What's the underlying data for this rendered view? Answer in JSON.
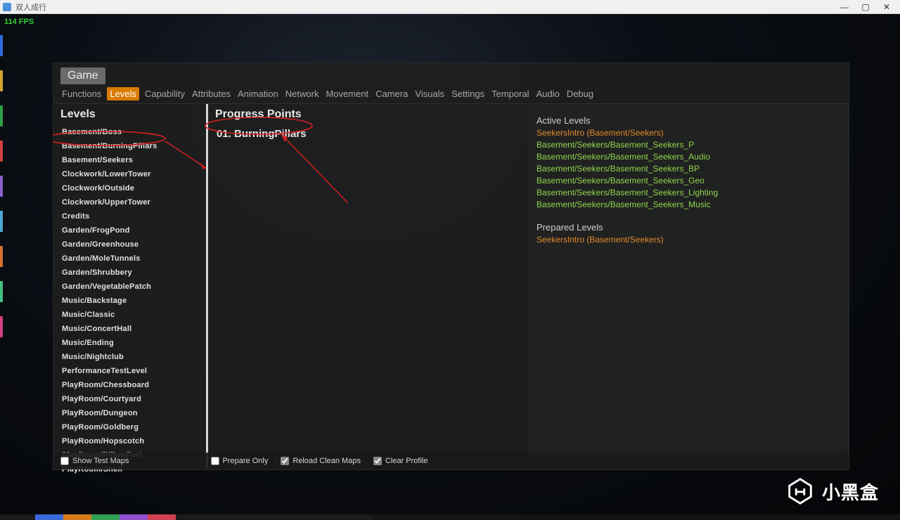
{
  "window": {
    "title": "双人成行"
  },
  "fps": "114 FPS",
  "panel": {
    "game_tab": "Game",
    "menu": {
      "items": [
        "Functions",
        "Levels",
        "Capability",
        "Attributes",
        "Animation",
        "Network",
        "Movement",
        "Camera",
        "Visuals",
        "Settings",
        "Temporal",
        "Audio",
        "Debug"
      ],
      "active": "Levels"
    }
  },
  "levels": {
    "title": "Levels",
    "items": [
      "Basement/Boss",
      "Basement/BurningPillars",
      "Basement/Seekers",
      "Clockwork/LowerTower",
      "Clockwork/Outside",
      "Clockwork/UpperTower",
      "Credits",
      "Garden/FrogPond",
      "Garden/Greenhouse",
      "Garden/MoleTunnels",
      "Garden/Shrubbery",
      "Garden/VegetablePatch",
      "Music/Backstage",
      "Music/Classic",
      "Music/ConcertHall",
      "Music/Ending",
      "Music/Nightclub",
      "PerformanceTestLevel",
      "PlayRoom/Chessboard",
      "PlayRoom/Courtyard",
      "PlayRoom/Dungeon",
      "PlayRoom/Goldberg",
      "PlayRoom/Hopscotch",
      "PlayRoom/PillowFort",
      "PlayRoom/Shelf"
    ],
    "circled_index": 1
  },
  "progress_points": {
    "title": "Progress Points",
    "items": [
      "01. BurningPillars"
    ],
    "circled_index": 0
  },
  "info": {
    "active_title": "Active Levels",
    "active": [
      {
        "text": "SeekersIntro (Basement/Seekers)",
        "color": "orange"
      },
      {
        "text": "Basement/Seekers/Basement_Seekers_P",
        "color": "green"
      },
      {
        "text": "Basement/Seekers/Basement_Seekers_Audio",
        "color": "green"
      },
      {
        "text": "Basement/Seekers/Basement_Seekers_BP",
        "color": "green"
      },
      {
        "text": "Basement/Seekers/Basement_Seekers_Geo",
        "color": "green"
      },
      {
        "text": "Basement/Seekers/Basement_Seekers_Lighting",
        "color": "green"
      },
      {
        "text": "Basement/Seekers/Basement_Seekers_Music",
        "color": "green"
      }
    ],
    "prepared_title": "Prepared Levels",
    "prepared": [
      {
        "text": "SeekersIntro (Basement/Seekers)",
        "color": "orange"
      }
    ]
  },
  "footer": {
    "show_test_maps": {
      "label": "Show Test Maps",
      "checked": false
    },
    "prepare_only": {
      "label": "Prepare Only",
      "checked": false
    },
    "reload_clean": {
      "label": "Reload Clean Maps",
      "checked": true
    },
    "clear_profile": {
      "label": "Clear Profile",
      "checked": true
    }
  },
  "watermark": "小黑盒"
}
